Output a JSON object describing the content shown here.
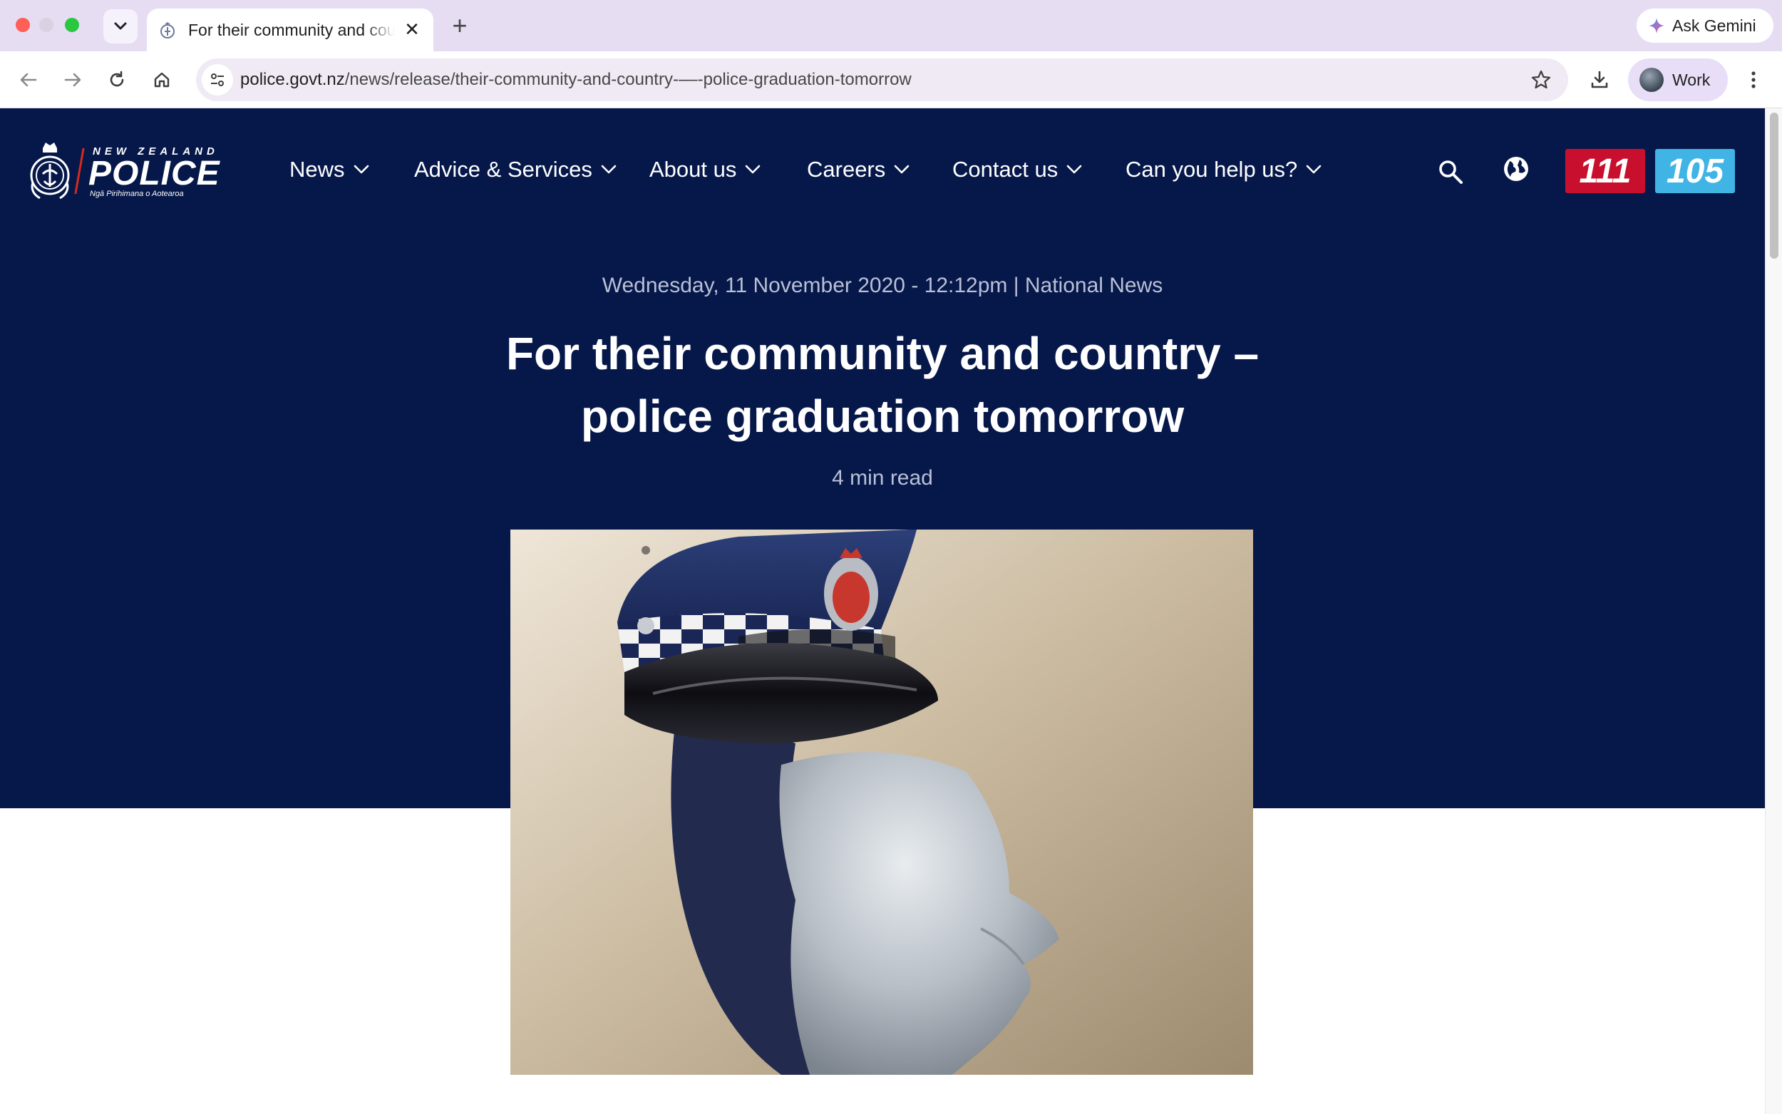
{
  "browser": {
    "tab_title": "For their community and country – police graduation tomorrow",
    "url_host": "police.govt.nz",
    "url_path": "/news/release/their-community-and-country-––-police-graduation-tomorrow",
    "ask_gemini": "Ask Gemini",
    "profile_label": "Work"
  },
  "site": {
    "logo": {
      "top_text": "NEW ZEALAND",
      "main_text": "POLICE",
      "sub_text": "Ngā Pirihimana o Aotearoa"
    },
    "nav": [
      {
        "label": "News"
      },
      {
        "label": "Advice & Services"
      },
      {
        "label": "About us"
      },
      {
        "label": "Careers"
      },
      {
        "label": "Contact us"
      },
      {
        "label": "Can you help us?"
      }
    ],
    "emergency_label": "111",
    "non_emergency_label": "105",
    "colors": {
      "navy": "#06184a",
      "emergency_red": "#c8102e",
      "non_emergency_blue": "#40b4e5"
    }
  },
  "article": {
    "meta": "Wednesday, 11 November 2020 - 12:12pm | National News",
    "title": "For their community and country – police graduation tomorrow",
    "read_time": "4 min read"
  }
}
